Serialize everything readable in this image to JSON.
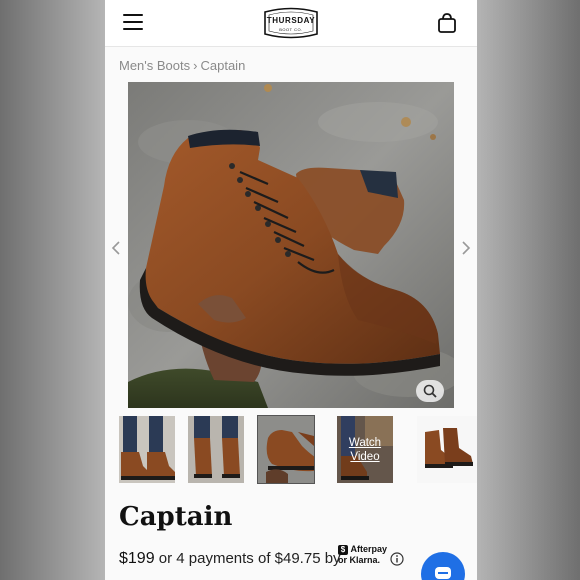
{
  "header": {
    "menu_icon": "hamburger-menu-icon",
    "logo_text": "THURSDAY",
    "logo_sub": "BOOT CO.",
    "cart_icon": "shopping-bag-icon"
  },
  "breadcrumb": {
    "category": "Men's Boots",
    "separator": "›",
    "current": "Captain"
  },
  "gallery": {
    "zoom_icon": "magnifier-icon",
    "prev_icon": "chevron-left-icon",
    "next_icon": "chevron-right-icon",
    "thumbnails": [
      {
        "kind": "photo"
      },
      {
        "kind": "photo"
      },
      {
        "kind": "photo",
        "active": true
      },
      {
        "kind": "video",
        "label_line1": "Watch",
        "label_line2": "Video"
      },
      {
        "kind": "photo"
      }
    ]
  },
  "product": {
    "title": "Captain",
    "price": "$199",
    "installments_text": "or 4 payments of $49.75 by",
    "afterpay_label": "Afterpay",
    "afterpay_badge": "$",
    "klarna_label": "or Klarna.",
    "info_icon": "info-circle-icon",
    "chat_icon": "chat-bubble-icon"
  },
  "colors": {
    "accent": "#1f6fe5",
    "leather": "#8a4a22",
    "breadcrumb": "#8a8a8a"
  }
}
